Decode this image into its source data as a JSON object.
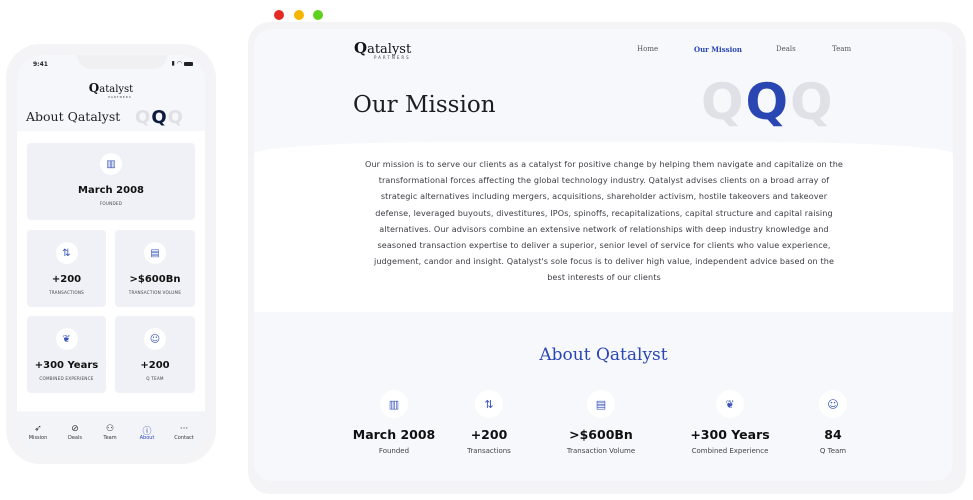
{
  "phone": {
    "status_time": "9:41",
    "logo": {
      "q": "Q",
      "word": "atalyst",
      "sub": "PARTNERS"
    },
    "title": "About Qatalyst",
    "qqq": [
      "Q",
      "Q",
      "Q"
    ],
    "cards": [
      {
        "icon": "building-icon",
        "glyph": "▥",
        "value": "March 2008",
        "label": "FOUNDED"
      },
      {
        "icon": "exchange-icon",
        "glyph": "⇅",
        "value": "+200",
        "label": "TRANSACTIONS"
      },
      {
        "icon": "money-hand-icon",
        "glyph": "▤",
        "value": ">$600Bn",
        "label": "TRANSACTION VOLUME"
      },
      {
        "icon": "laurel-icon",
        "glyph": "❦",
        "value": "+300 Years",
        "label": "COMBINED EXPERIENCE"
      },
      {
        "icon": "team-icon",
        "glyph": "☺",
        "value": "+200",
        "label": "Q TEAM"
      }
    ],
    "tabs": [
      {
        "label": "Mission",
        "glyph": "➶",
        "icon": "rocket-icon"
      },
      {
        "label": "Deals",
        "glyph": "⊘",
        "icon": "tag-icon"
      },
      {
        "label": "Team",
        "glyph": "⚇",
        "icon": "users-icon"
      },
      {
        "label": "About",
        "glyph": "ⓘ",
        "icon": "info-icon"
      },
      {
        "label": "Contact",
        "glyph": "···",
        "icon": "more-icon"
      }
    ],
    "active_tab": "About"
  },
  "browser": {
    "logo": {
      "q": "Q",
      "word": "atalyst",
      "sub": "PARTNERS"
    },
    "nav": [
      {
        "label": "Home"
      },
      {
        "label": "Our Mission"
      },
      {
        "label": "Deals"
      },
      {
        "label": "Team"
      }
    ],
    "active_nav": "Our Mission",
    "hero_title": "Our Mission",
    "qqq": [
      "Q",
      "Q",
      "Q"
    ],
    "mission_text": "Our mission is to serve our clients as a catalyst for positive change by helping them navigate and capitalize on the transformational forces affecting the global technology industry. Qatalyst advises clients on a broad array of strategic alternatives including mergers, acquisitions, shareholder activism, hostile takeovers and takeover defense, leveraged buyouts, divestitures, IPOs, spinoffs, recapitalizations, capital structure and capital raising alternatives. Our advisors combine an extensive network of relationships with deep industry knowledge and seasoned transaction expertise to deliver a superior, senior level of service for clients who value experience, judgement, candor and insight. Qatalyst's sole focus is to deliver high value, independent advice based on the best interests of our clients",
    "about_title": "About Qatalyst",
    "stats": [
      {
        "icon": "building-icon",
        "glyph": "▥",
        "value": "March 2008",
        "label": "Founded"
      },
      {
        "icon": "exchange-icon",
        "glyph": "⇅",
        "value": "+200",
        "label": "Transactions"
      },
      {
        "icon": "money-hand-icon",
        "glyph": "▤",
        "value": ">$600Bn",
        "label": "Transaction Volume"
      },
      {
        "icon": "laurel-icon",
        "glyph": "❦",
        "value": "+300 Years",
        "label": "Combined Experience"
      },
      {
        "icon": "team-icon",
        "glyph": "☺",
        "value": "84",
        "label": "Q Team"
      }
    ]
  },
  "colors": {
    "accent": "#2a46b2",
    "close": "#e52a24",
    "minimize": "#f7b500",
    "maximize": "#5ed01c"
  }
}
